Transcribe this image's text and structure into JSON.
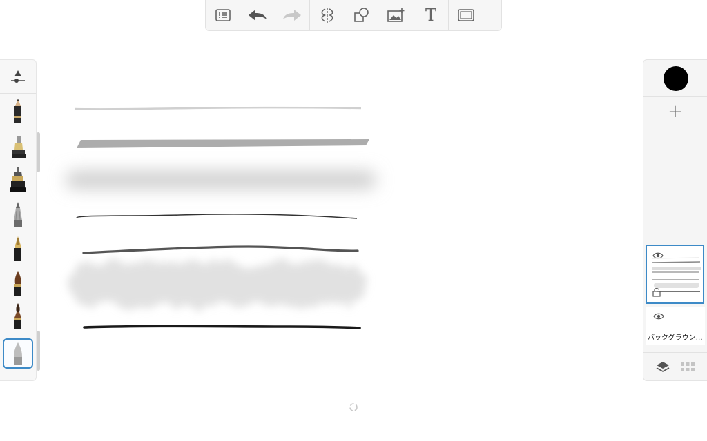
{
  "toolbar": {
    "items": [
      "list-icon",
      "undo-icon",
      "redo-icon",
      "symmetry-icon",
      "shapes-icon",
      "add-image-icon",
      "text-icon",
      "fullscreen-icon"
    ],
    "text_tool_glyph": "T"
  },
  "brush_panel": {
    "brushes": [
      "pencil",
      "marker",
      "ink-pen",
      "airbrush",
      "fountain-pen",
      "paint-brush",
      "brush-pen",
      "soft-eraser"
    ],
    "selected": "soft-eraser"
  },
  "layers": {
    "current_color": "#000000",
    "add_glyph": "+",
    "background_layer_name": "バックグラウン…"
  },
  "colors": {
    "accent": "#3d8ac7",
    "panel_bg": "#f5f5f5"
  }
}
